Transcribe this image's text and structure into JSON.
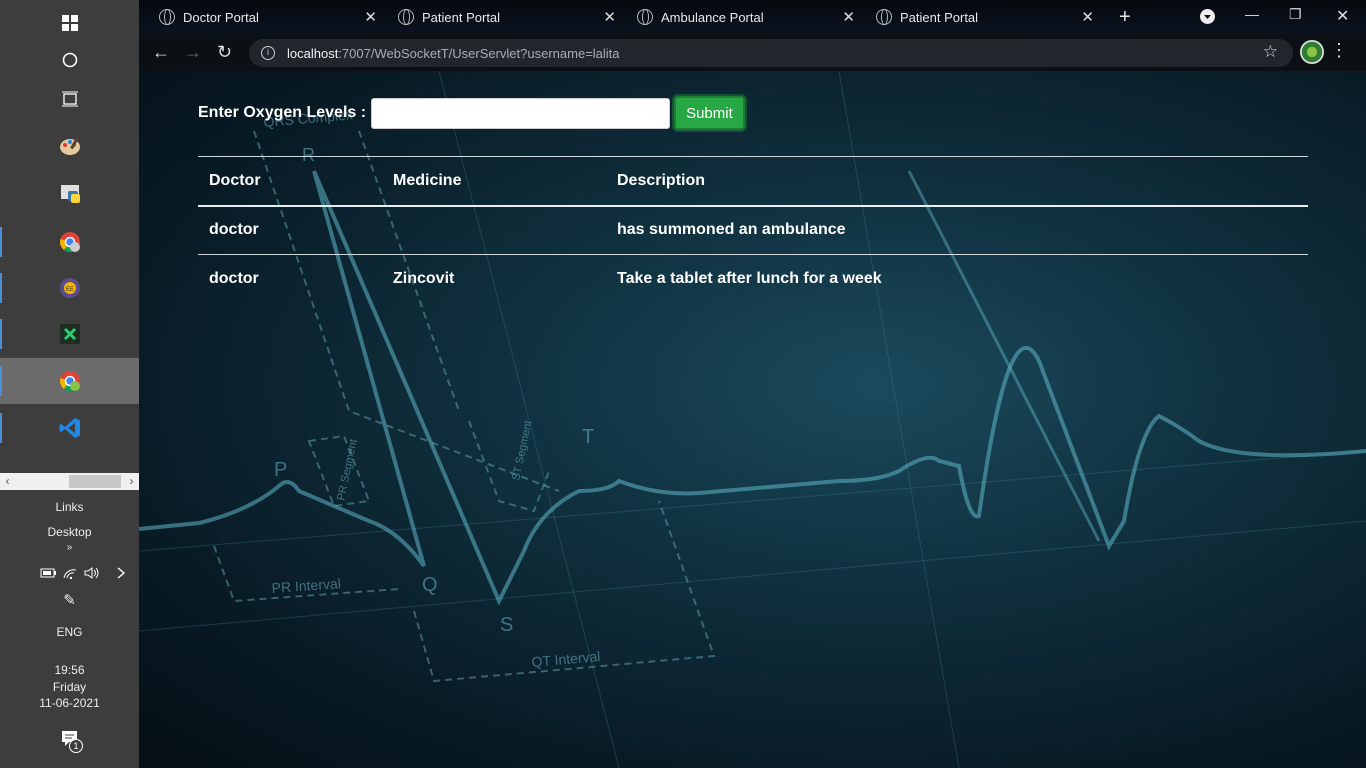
{
  "taskbar": {
    "apps": [
      {
        "name": "start-icon"
      },
      {
        "name": "cortana-icon"
      },
      {
        "name": "task-view-icon"
      },
      {
        "name": "paint-icon"
      },
      {
        "name": "python-icon"
      },
      {
        "name": "chrome-icon"
      },
      {
        "name": "javaee-icon"
      },
      {
        "name": "excel-icon"
      },
      {
        "name": "chrome-icon-active"
      },
      {
        "name": "vscode-icon"
      }
    ],
    "links_label": "Links",
    "desktop_label": "Desktop",
    "language": "ENG",
    "time": "19:56",
    "day": "Friday",
    "date": "11-06-2021",
    "notification_count": "1"
  },
  "tabs": [
    {
      "title": "Doctor Portal"
    },
    {
      "title": "Patient Portal"
    },
    {
      "title": "Ambulance Portal"
    },
    {
      "title": "Patient Portal"
    }
  ],
  "address": {
    "host": "localhost",
    "path": ":7007/WebSocketT/UserServlet?username=lalita"
  },
  "form": {
    "label": "Enter Oxygen Levels :",
    "input_value": "",
    "submit_label": "Submit"
  },
  "table": {
    "headers": [
      "Doctor",
      "Medicine",
      "Description"
    ],
    "rows": [
      [
        "doctor",
        "",
        "has summoned an ambulance"
      ],
      [
        "doctor",
        "Zincovit",
        "Take a tablet after lunch for a week"
      ]
    ]
  },
  "background_labels": {
    "qrs": "QRS Complex",
    "r": "R",
    "p": "P",
    "q": "Q",
    "s": "S",
    "t": "T",
    "pr_segment": "PR Segment",
    "st_segment": "ST Segment",
    "pr_interval": "PR Interval",
    "qt_interval": "QT Interval"
  },
  "colors": {
    "accent_submit": "#28a745",
    "taskbar": "#3d3d3d",
    "page_bg": "#0b1b24"
  }
}
